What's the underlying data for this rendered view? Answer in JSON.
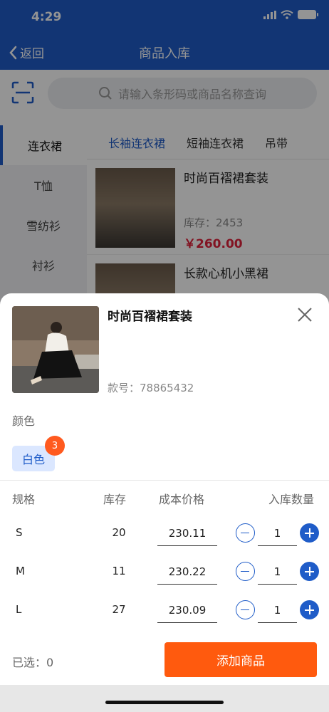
{
  "status_bar": {
    "time": "4:29"
  },
  "nav": {
    "back_label": "返回",
    "title": "商品入库"
  },
  "search": {
    "placeholder": "请输入条形码或商品名称查询"
  },
  "categories": [
    "连衣裙",
    "T恤",
    "雪纺衫",
    "衬衫"
  ],
  "subtabs": [
    "长袖连衣裙",
    "短袖连衣裙",
    "吊带"
  ],
  "products": [
    {
      "name": "时尚百褶裙套装",
      "stock": "库存：2453",
      "price": "￥260.00"
    },
    {
      "name": "长款心机小黑裙"
    }
  ],
  "sheet": {
    "title": "时尚百褶裙套装",
    "code": "款号：78865432",
    "color_label": "颜色",
    "color_option": "白色",
    "color_badge": "3",
    "headers": {
      "size": "规格",
      "stock": "库存",
      "cost": "成本价格",
      "qty": "入库数量"
    },
    "rows": [
      {
        "size": "S",
        "stock": "20",
        "price": "230.11",
        "qty": "1"
      },
      {
        "size": "M",
        "stock": "11",
        "price": "230.22",
        "qty": "1"
      },
      {
        "size": "L",
        "stock": "27",
        "price": "230.09",
        "qty": "1"
      }
    ],
    "selected": "已选：0",
    "add_button": "添加商品"
  },
  "colors": {
    "brand_blue": "#1f5cc8",
    "accent_orange": "#ff5a0e",
    "price_red": "#e0213c"
  }
}
